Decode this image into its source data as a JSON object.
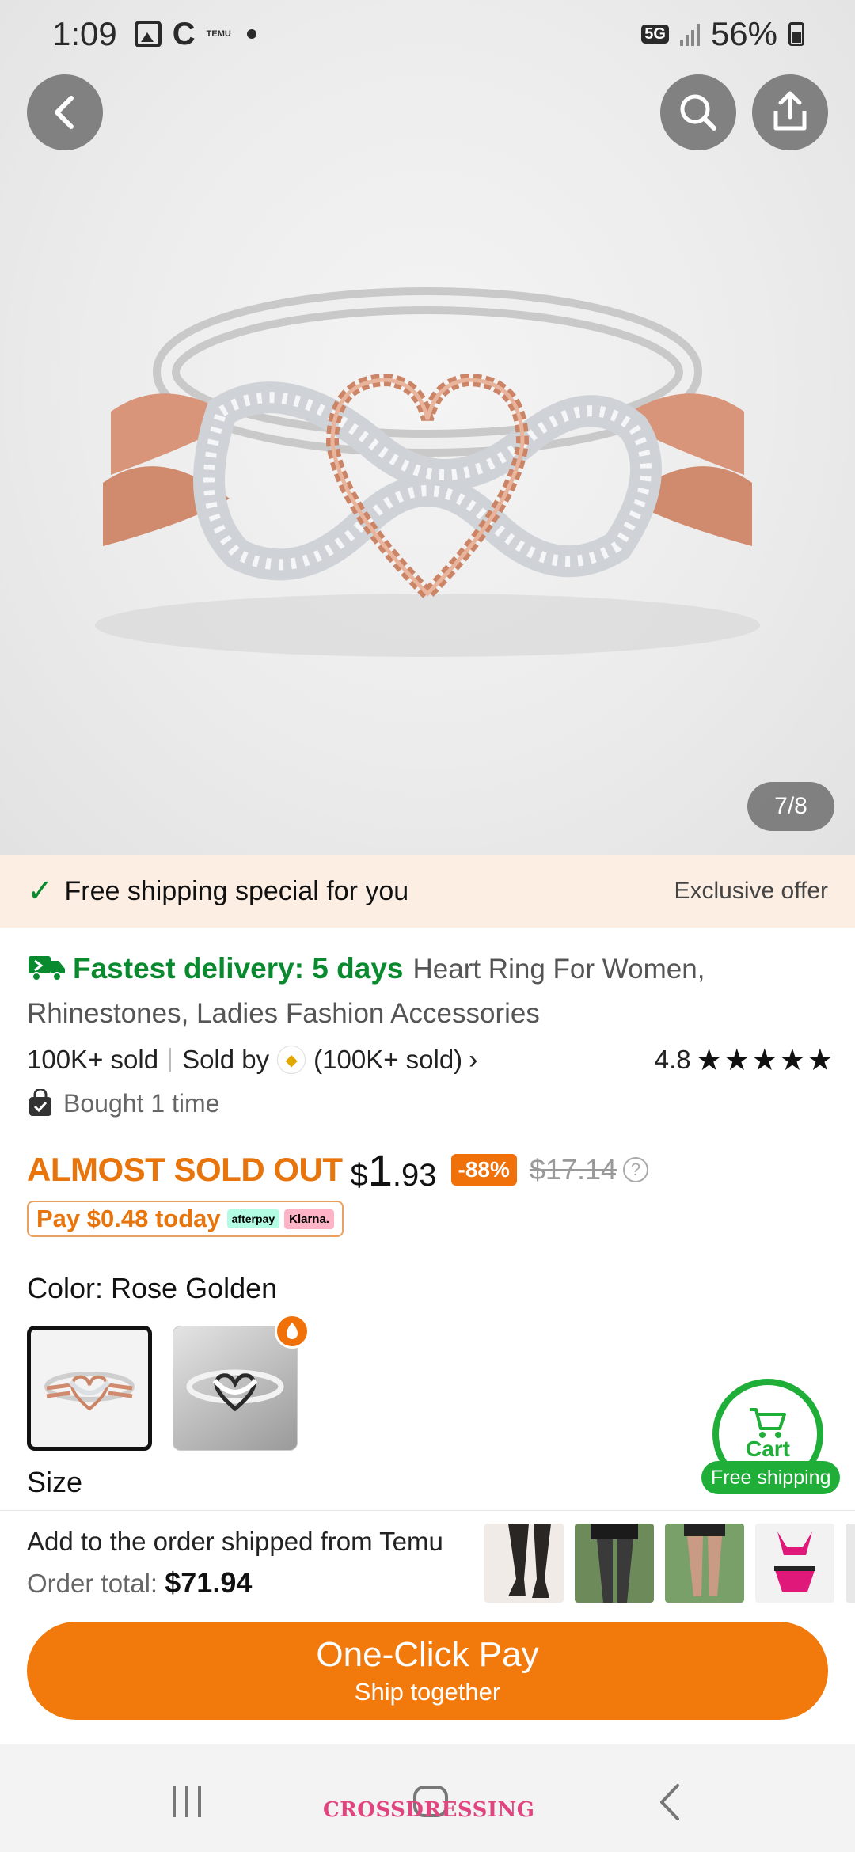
{
  "status_bar": {
    "time": "1:09",
    "temu_icon_text": "TEMU",
    "network": "5G",
    "battery": "56%"
  },
  "hero": {
    "image_counter": "7/8",
    "image_description_icon": "ring-product-photo"
  },
  "shipping_banner": {
    "title": "Free shipping special for you",
    "offer": "Exclusive offer"
  },
  "product": {
    "delivery": "Fastest delivery: 5 days",
    "title": "Heart Ring For Women, Rhinestones, Ladies Fashion Accessories",
    "sold": "100K+ sold",
    "sold_by_label": "Sold by",
    "seller_sold": "(100K+ sold)",
    "rating": "4.8",
    "stars": "★★★★★",
    "bought": "Bought 1 time",
    "almost_sold_out": "ALMOST SOLD OUT",
    "price_currency": "$",
    "price_whole": "1",
    "price_cents": ".93",
    "discount": "-88%",
    "original_price": "$17.14",
    "pay_today": "Pay $0.48 today",
    "afterpay": "afterpay",
    "klarna": "Klarna.",
    "color_label": "Color: Rose Golden",
    "size_label": "Size"
  },
  "cart_fab": {
    "label": "Cart",
    "free_shipping": "Free shipping"
  },
  "order_bar": {
    "line1": "Add to the order shipped from Temu",
    "total_label": "Order total:",
    "total_value": "$71.94",
    "button_main": "One-Click Pay",
    "button_sub": "Ship together"
  },
  "nav": {
    "watermark": "CROSSDRESSING"
  },
  "colors": {
    "accent_orange": "#f27a0c",
    "green": "#0a8a2f",
    "banner_bg": "#fdeee3"
  }
}
